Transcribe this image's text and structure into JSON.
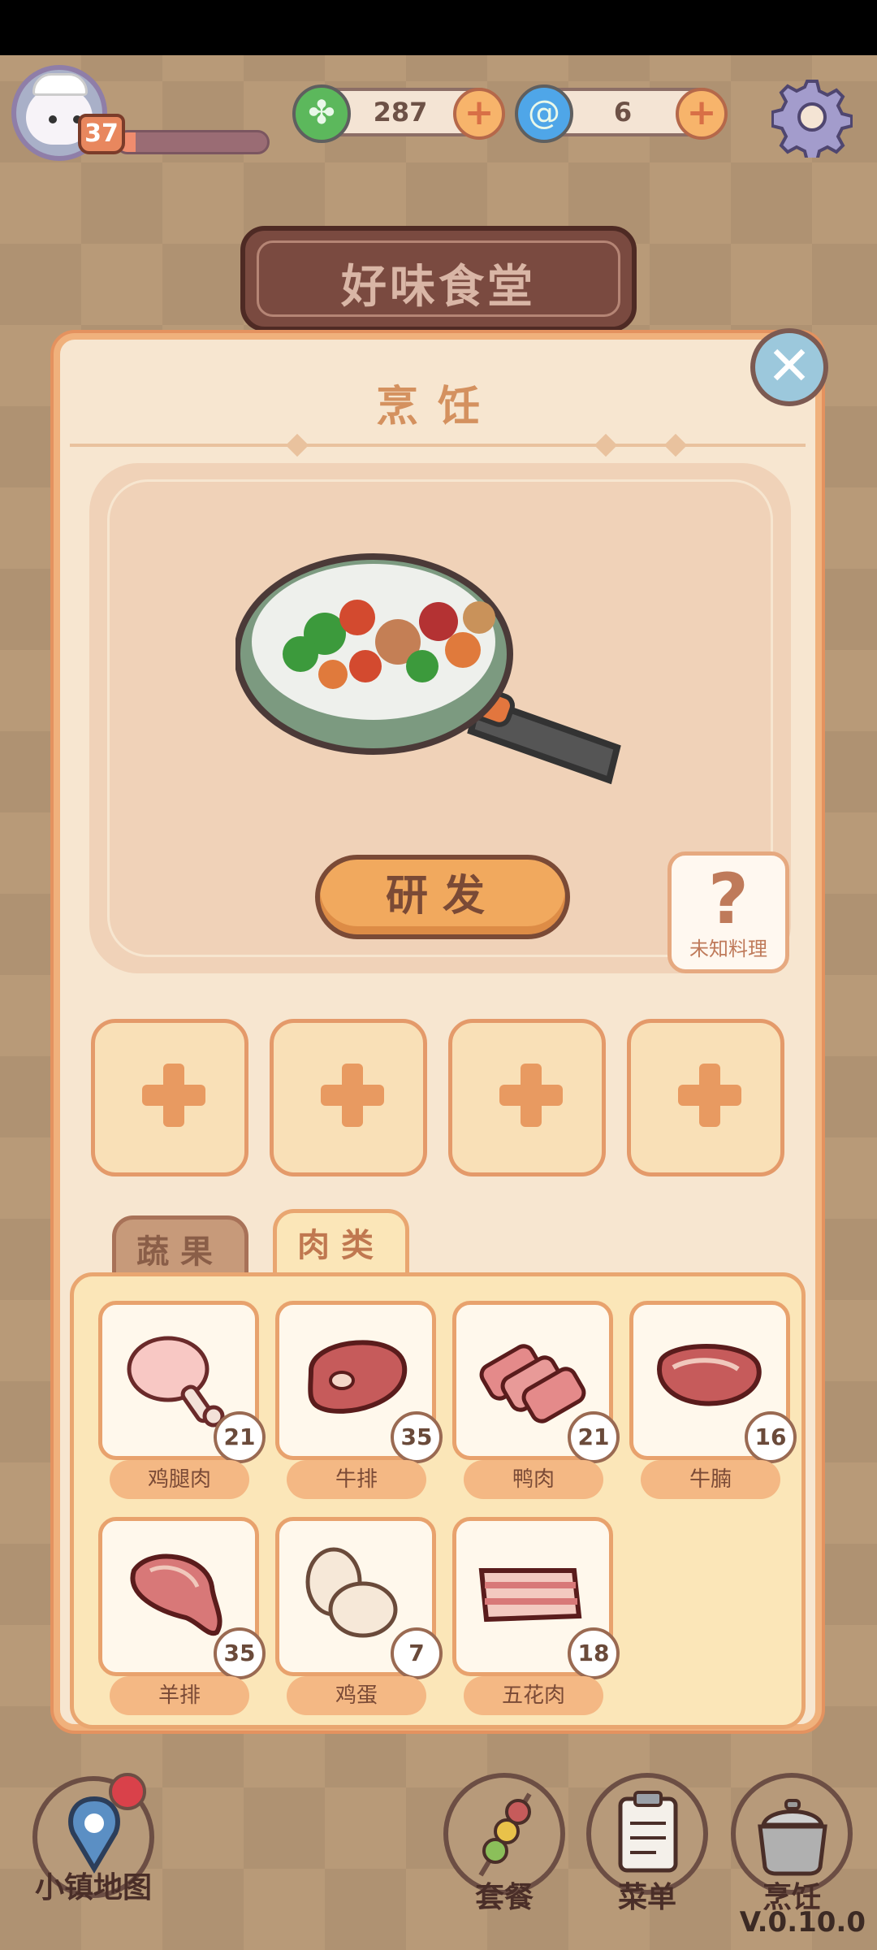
{
  "hud": {
    "level": "37",
    "xp_progress": 0.12,
    "leaf_amount": "287",
    "gem_amount": "6"
  },
  "sign": {
    "title": "好味食堂"
  },
  "panel": {
    "title": "烹饪",
    "research_label": "研发",
    "unknown_label": "未知料理",
    "unknown_symbol": "?",
    "tabs": [
      {
        "label": "蔬果",
        "active": false
      },
      {
        "label": "肉类",
        "active": true
      }
    ],
    "ingredients": [
      {
        "name": "鸡腿肉",
        "count": "21",
        "icon": "chicken-leg-icon"
      },
      {
        "name": "牛排",
        "count": "35",
        "icon": "steak-icon"
      },
      {
        "name": "鸭肉",
        "count": "21",
        "icon": "duck-slices-icon"
      },
      {
        "name": "牛腩",
        "count": "16",
        "icon": "brisket-icon"
      },
      {
        "name": "羊排",
        "count": "35",
        "icon": "lamb-chop-icon"
      },
      {
        "name": "鸡蛋",
        "count": "7",
        "icon": "eggs-icon"
      },
      {
        "name": "五花肉",
        "count": "18",
        "icon": "pork-belly-icon"
      }
    ]
  },
  "nav": {
    "map_label": "小镇地图",
    "set_label": "套餐",
    "menu_label": "菜单",
    "cook_label": "烹饪"
  },
  "version": "V.0.10.0",
  "colors": {
    "accent": "#f1a95e",
    "panel": "#f7e6d0",
    "brown": "#7a4a36"
  }
}
